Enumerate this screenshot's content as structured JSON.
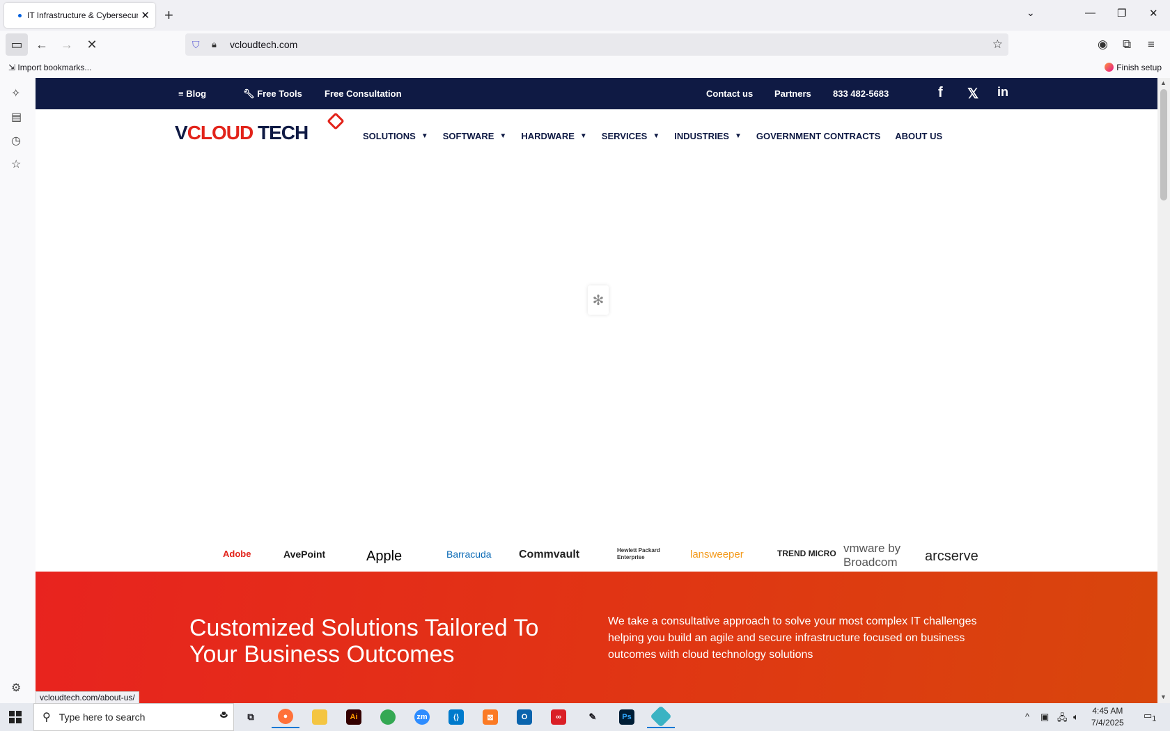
{
  "browser": {
    "tab_title": "IT Infrastructure & Cybersecurit",
    "url": "vcloudtech.com",
    "import_bookmarks": "Import bookmarks...",
    "finish_setup": "Finish setup",
    "status_url": "vcloudtech.com/about-us/"
  },
  "site": {
    "topbar": {
      "blog": "Blog",
      "free_tools": "Free Tools",
      "free_consultation": "Free Consultation",
      "contact": "Contact us",
      "partners": "Partners",
      "phone": "833 482-5683"
    },
    "logo": {
      "v": "V",
      "cloud": "CLOUD",
      "tech": " TECH"
    },
    "menu": {
      "solutions": "SOLUTIONS",
      "software": "SOFTWARE",
      "hardware": "HARDWARE",
      "services": "SERVICES",
      "industries": "INDUSTRIES",
      "government": "GOVERNMENT CONTRACTS",
      "about": "ABOUT US"
    },
    "brands": [
      "Adobe",
      "AvePoint",
      "Apple",
      "Barracuda",
      "Commvault",
      "Hewlett Packard Enterprise",
      "lansweeper",
      "TREND MICRO",
      "vmware by Broadcom",
      "arcserve"
    ],
    "hero": {
      "title": "Customized Solutions Tailored To Your Business Outcomes",
      "text": "We take a consultative approach to solve your most complex IT challenges helping you build an agile and secure infrastructure focused on business outcomes with cloud technology solutions"
    }
  },
  "taskbar": {
    "search_placeholder": "Type here to search",
    "time": "4:45 AM",
    "date": "7/4/2025",
    "notifications": "1"
  },
  "colors": {
    "navy": "#0f1a44",
    "brand_red": "#e2231a",
    "hero_start": "#e8231f",
    "hero_end": "#d8460c"
  }
}
